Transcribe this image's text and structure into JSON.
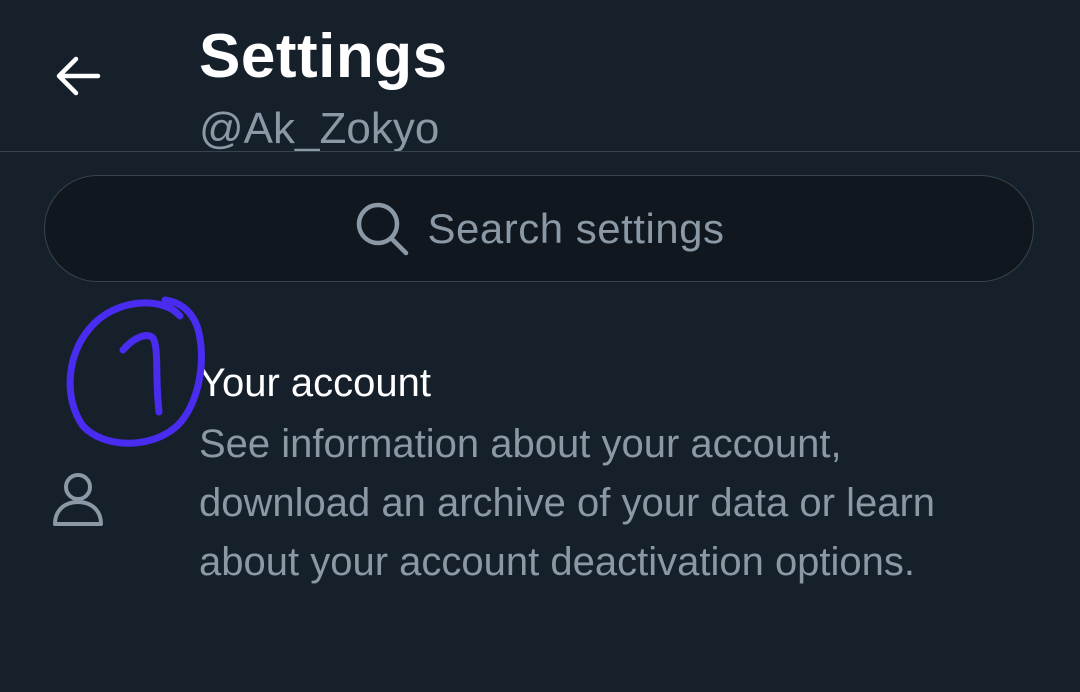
{
  "header": {
    "title": "Settings",
    "handle": "@Ak_Zokyo",
    "back_icon": "arrow-left-icon"
  },
  "search": {
    "placeholder": "Search settings",
    "icon": "search-icon"
  },
  "settings_items": [
    {
      "icon": "person-icon",
      "title": "Your account",
      "description": "See information about your account, download an archive of your data or learn about your account deactivation options."
    }
  ],
  "annotation": {
    "icon": "handwritten-circled-one",
    "color": "#4a2cf0"
  },
  "colors": {
    "background": "#15202b",
    "primary_text": "#ffffff",
    "secondary_text": "#8b98a5",
    "border": "#38444d"
  }
}
